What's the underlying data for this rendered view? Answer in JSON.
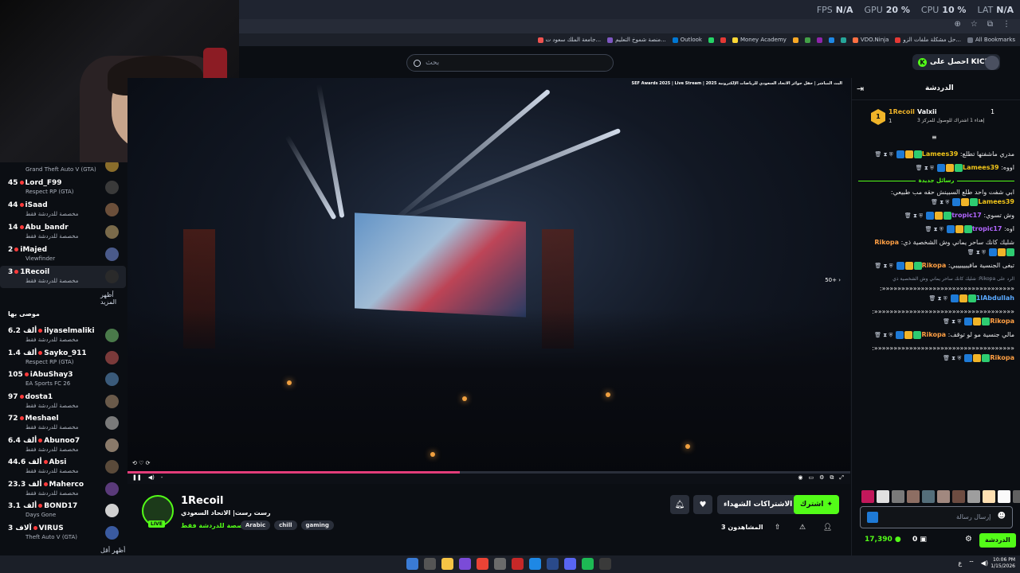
{
  "perf": {
    "fps_label": "FPS",
    "fps": "N/A",
    "gpu_label": "GPU",
    "gpu": "20 %",
    "cpu_label": "CPU",
    "cpu": "10 %",
    "lat_label": "LAT",
    "lat": "N/A"
  },
  "bookmarks": {
    "all": "All Bookmarks",
    "items": [
      "حل مشكلة ملفات الزو...",
      "VDO.Ninja",
      "Money Academy",
      "Outlook",
      "منصة شموخ التعليم...",
      "جامعة الملك سعود ت..."
    ]
  },
  "header": {
    "search_placeholder": "بحث",
    "get_kicks": "احصل على KICKs"
  },
  "sidebar": {
    "following": [
      {
        "name": "",
        "category": "Grand Theft Auto V (GTA)"
      },
      {
        "count": "45",
        "name": "Lord_F99",
        "category": "Respect RP (GTA)"
      },
      {
        "count": "44",
        "name": "iSaad",
        "category": "مخصصة للدردشة فقط"
      },
      {
        "count": "14",
        "name": "Abu_bandr",
        "category": "مخصصة للدردشة فقط"
      },
      {
        "count": "2",
        "name": "iMajed",
        "category": "Viewfinder"
      },
      {
        "count": "3",
        "name": "1Recoil",
        "category": "مخصصة للدردشة فقط"
      }
    ],
    "show_more": "أظهر المزيد",
    "show_less": "أظهر أقل",
    "recommended_title": "موصى بها",
    "recommended": [
      {
        "count": "6.2 ألف",
        "name": "ilyaselmaliki",
        "category": "مخصصة للدردشة فقط"
      },
      {
        "count": "1.4 ألف",
        "name": "Sayko_911",
        "category": "Respect RP (GTA)"
      },
      {
        "count": "105",
        "name": "iAbuShay3",
        "category": "EA Sports FC 26"
      },
      {
        "count": "97",
        "name": "dosta1",
        "category": "مخصصة للدردشة فقط"
      },
      {
        "count": "72",
        "name": "Meshael",
        "category": "مخصصة للدردشة فقط"
      },
      {
        "count": "6.4 ألف",
        "name": "Abunoo7",
        "category": "مخصصة للدردشة فقط"
      },
      {
        "count": "44.6 ألف",
        "name": "Absi",
        "category": "مخصصة للدردشة فقط"
      },
      {
        "count": "23.3 ألف",
        "name": "Maherco",
        "category": "مخصصة للدردشة فقط"
      },
      {
        "count": "3.1 ألف",
        "name": "BOND17",
        "category": "Days Gone"
      },
      {
        "count": "3 آلاف",
        "name": "VIRUS",
        "category": "Theft Auto V (GTA)"
      }
    ]
  },
  "video": {
    "banner": "SEF Awards 2025 | Live Stream | البث المباشر | حفل جوائز الاتحاد السعودي للرياضات الإلكترونية 2025",
    "skip": "50+",
    "time": "-"
  },
  "stream": {
    "channel": "1Recoil",
    "live": "LIVE",
    "title": "رست رست| الاتحاد السعودي",
    "category": "مخصصة للدردشة فقط",
    "tags": [
      "Arabic",
      "chill",
      "gaming"
    ],
    "subscribe": "اشترك",
    "gift": "الاشتراكات الشهداء",
    "viewers_label": "المشاهدون",
    "viewers": "3"
  },
  "chat": {
    "title": "الدردشة",
    "leader1_name": "1Recoil",
    "leader1_count": "1",
    "leader2_name": "Valxii",
    "leader2_caption": "إهداء 1 اشتراك للوصول للمركز 3",
    "leader3": "1",
    "new_messages": "رسائل جديدة",
    "messages": [
      {
        "user": "Lamees39",
        "color": "#f0c419",
        "text": "مدري ماشفتها تطلع"
      },
      {
        "user": "Lamees39",
        "color": "#f0c419",
        "text": "اووه"
      },
      {
        "user": "Lamees39",
        "color": "#f0c419",
        "text": "ابي شفت واحد طلع السبينش حقه مب طبيعي"
      },
      {
        "user": "tropic17",
        "color": "#b266ff",
        "text": "وش تسوي"
      },
      {
        "user": "tropic17",
        "color": "#b266ff",
        "text": "اوه"
      },
      {
        "user": "Rikopa",
        "color": "#ff9f43",
        "text": "شليك كانك ساحر يماني وش الشخصية ذي"
      },
      {
        "user": "Rikopa",
        "color": "#ff9f43",
        "text": "تبغى الجنسية مافيييييييي"
      },
      {
        "user": "1lAbdullah",
        "color": "#5aa9ff",
        "text": "««««««««««««««««««««««««««««««««««",
        "reply": "الرد على Rikopa: شليك كانك ساحر يماني وش الشخصية ذي"
      },
      {
        "user": "Rikopa",
        "color": "#ff9f43",
        "text": "««««««««««««««««««««««««««««««««««««"
      },
      {
        "user": "Rikopa",
        "color": "#ff9f43",
        "text": "مالي جنسية مو لو توقف"
      },
      {
        "user": "Rikopa",
        "color": "#ff9f43",
        "text": "««««««««««««««««««««««««««««««««««««"
      }
    ],
    "input_placeholder": "إرسال رسالة",
    "send": "الدردشة",
    "points": "17,390",
    "zero": "0"
  },
  "taskbar": {
    "time": "10:06 PM",
    "date": "1/15/2026",
    "lang": "ع"
  },
  "colors": {
    "accent": "#53fc18",
    "live_dot": "#ff3b3b",
    "progress": "#e33d7a"
  }
}
